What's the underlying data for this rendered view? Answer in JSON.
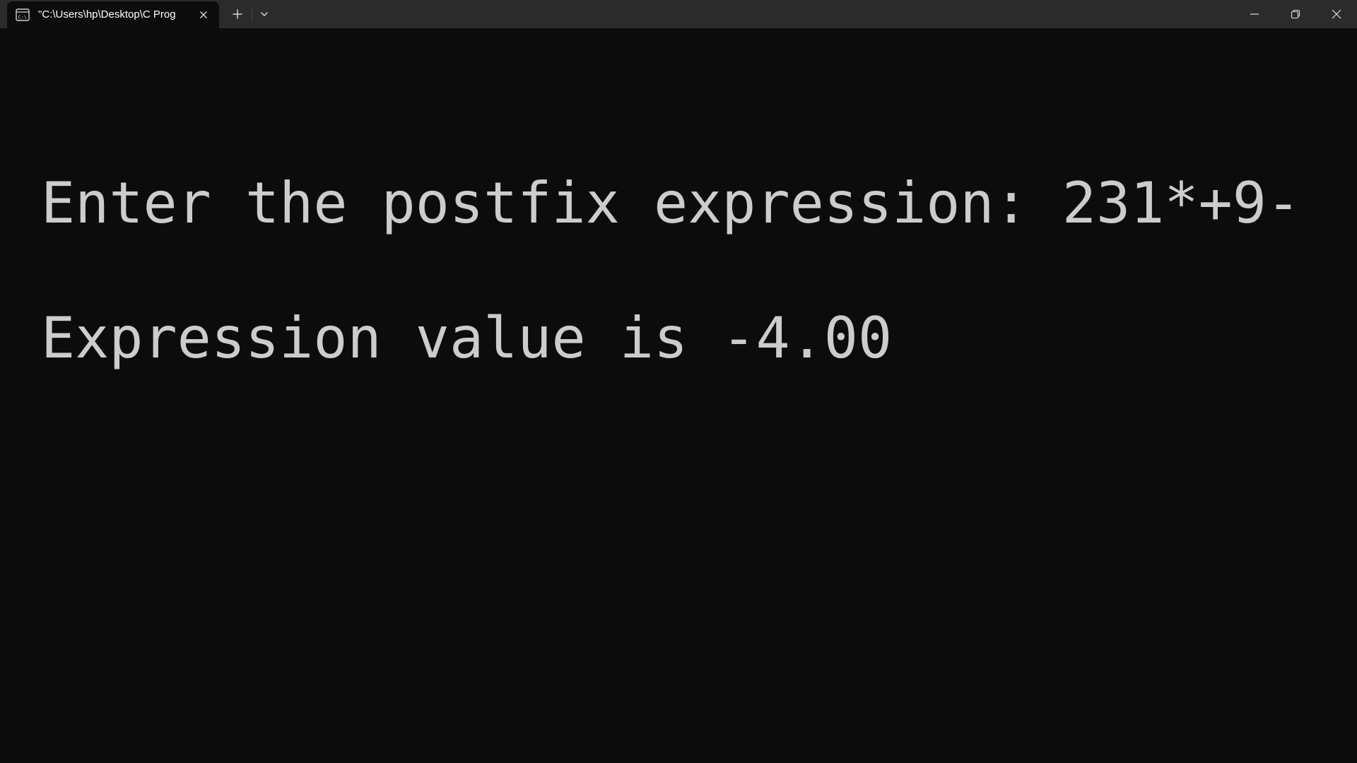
{
  "window": {
    "tab_title": "\"C:\\Users\\hp\\Desktop\\C Prog",
    "tab_icon": "terminal-icon",
    "new_tab_icon": "plus-icon",
    "dropdown_icon": "chevron-down-icon",
    "minimize_icon": "minimize-icon",
    "maximize_icon": "restore-icon",
    "close_icon": "close-icon"
  },
  "terminal": {
    "lines": [
      "Enter the postfix expression: 231*+9-",
      "Expression value is -4.00"
    ]
  },
  "colors": {
    "background": "#0c0c0c",
    "titlebar": "#2b2b2b",
    "text": "#cccccc"
  }
}
